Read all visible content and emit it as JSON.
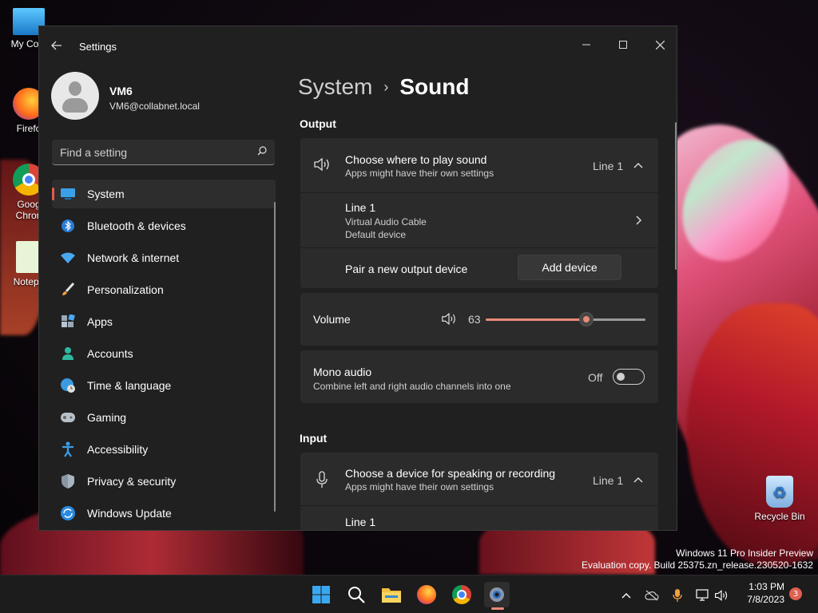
{
  "desktop": {
    "icons": [
      {
        "label": "My Com"
      },
      {
        "label": "Firefo"
      },
      {
        "label": "Goog Chron"
      },
      {
        "label": "Notepa"
      },
      {
        "label": "Recycle Bin"
      }
    ],
    "watermark": {
      "line1": "Windows 11 Pro Insider Preview",
      "line2": "Evaluation copy. Build 25375.zn_release.230520-1632"
    }
  },
  "window": {
    "title": "Settings",
    "back_icon": "back-arrow-icon",
    "controls": [
      "minimize",
      "maximize",
      "close"
    ]
  },
  "profile": {
    "name": "VM6",
    "email": "VM6@collabnet.local"
  },
  "search": {
    "placeholder": "Find a setting"
  },
  "nav": {
    "items": [
      {
        "label": "System",
        "icon": "monitor-icon",
        "active": true
      },
      {
        "label": "Bluetooth & devices",
        "icon": "bluetooth-icon"
      },
      {
        "label": "Network & internet",
        "icon": "wifi-icon"
      },
      {
        "label": "Personalization",
        "icon": "brush-icon"
      },
      {
        "label": "Apps",
        "icon": "apps-icon"
      },
      {
        "label": "Accounts",
        "icon": "person-icon"
      },
      {
        "label": "Time & language",
        "icon": "globe-clock-icon"
      },
      {
        "label": "Gaming",
        "icon": "gamepad-icon"
      },
      {
        "label": "Accessibility",
        "icon": "accessibility-icon"
      },
      {
        "label": "Privacy & security",
        "icon": "shield-icon"
      },
      {
        "label": "Windows Update",
        "icon": "update-icon"
      }
    ]
  },
  "breadcrumb": {
    "parent": "System",
    "separator": "›",
    "current": "Sound"
  },
  "output": {
    "section_title": "Output",
    "choose": {
      "title": "Choose where to play sound",
      "subtitle": "Apps might have their own settings",
      "value": "Line 1"
    },
    "device": {
      "title": "Line 1",
      "line2": "Virtual Audio Cable",
      "line3": "Default device"
    },
    "pair": {
      "title": "Pair a new output device",
      "button": "Add device"
    },
    "volume": {
      "label": "Volume",
      "value": "63",
      "level": 63
    },
    "mono": {
      "title": "Mono audio",
      "subtitle": "Combine left and right audio channels into one",
      "state": "Off"
    }
  },
  "input": {
    "section_title": "Input",
    "choose": {
      "title": "Choose a device for speaking or recording",
      "subtitle": "Apps might have their own settings",
      "value": "Line 1"
    },
    "device": {
      "title": "Line 1"
    }
  },
  "taskbar": {
    "apps": [
      "start-icon",
      "search-icon",
      "file-explorer-icon",
      "firefox-icon",
      "chrome-icon",
      "settings-icon"
    ],
    "time": "1:03 PM",
    "date": "7/8/2023",
    "notification_count": "3"
  },
  "colors": {
    "accent": "#e88a78",
    "window_bg": "#202020",
    "card_bg": "#2b2b2b"
  }
}
